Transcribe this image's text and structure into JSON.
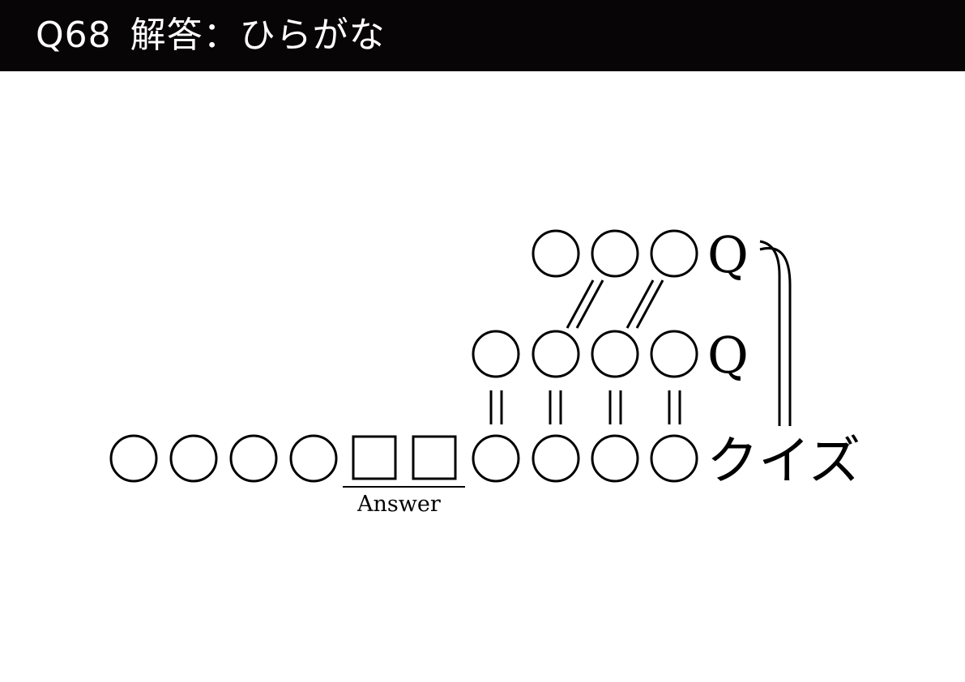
{
  "header": {
    "title": "Q68 解答：ひらがな"
  },
  "puzzle": {
    "row_top": {
      "circle_count": 3,
      "suffix": "Q"
    },
    "row_middle": {
      "circle_count": 4,
      "suffix": "Q"
    },
    "row_bottom": {
      "circle_count_before": 4,
      "box_count": 2,
      "circle_count_after": 4,
      "suffix": "クイズ"
    },
    "answer_label": "Answer"
  }
}
